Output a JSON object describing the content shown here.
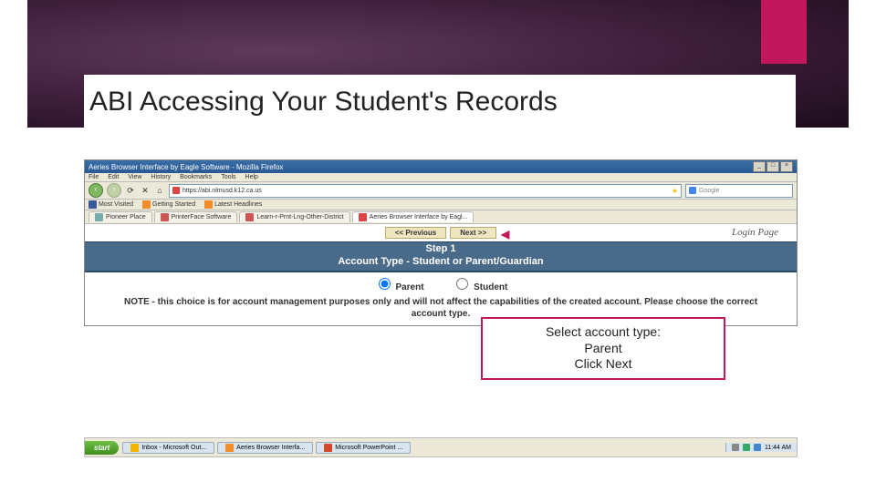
{
  "slide": {
    "title": "ABI Accessing Your Student's Records"
  },
  "browser": {
    "window_title": "Aeries Browser Interface by Eagle Software - Mozilla Firefox",
    "menu": {
      "file": "File",
      "edit": "Edit",
      "view": "View",
      "history": "History",
      "bookmarks": "Bookmarks",
      "tools": "Tools",
      "help": "Help"
    },
    "address": "https://abi.nlmusd.k12.ca.us",
    "search_engine": "Google",
    "bookmarks": {
      "most_visited": "Most Visited",
      "getting_started": "Getting Started",
      "latest": "Latest Headlines"
    },
    "tabs": {
      "t1": "Pioneer Place",
      "t2": "PrinterFace Software",
      "t3": "Learn-r-Prnt-Lng-Other-District",
      "t4": "Aeries Browser Interface by Eagl..."
    }
  },
  "page": {
    "prev": "<< Previous",
    "next": "Next >>",
    "login_label": "Login Page",
    "step": "Step 1",
    "subtitle": "Account Type - Student or Parent/Guardian",
    "radio_parent": "Parent",
    "radio_student": "Student",
    "note": "NOTE - this choice is for account management purposes only and will not affect the capabilities of the created account. Please choose the correct account type."
  },
  "callout": {
    "line1": "Select account type:",
    "line2": "Parent",
    "line3": "Click Next"
  },
  "taskbar": {
    "start": "start",
    "item1": "Inbox - Microsoft Out...",
    "item2": "Aeries Browser Interfa...",
    "item3": "Microsoft PowerPoint ...",
    "clock": "11:44 AM"
  }
}
